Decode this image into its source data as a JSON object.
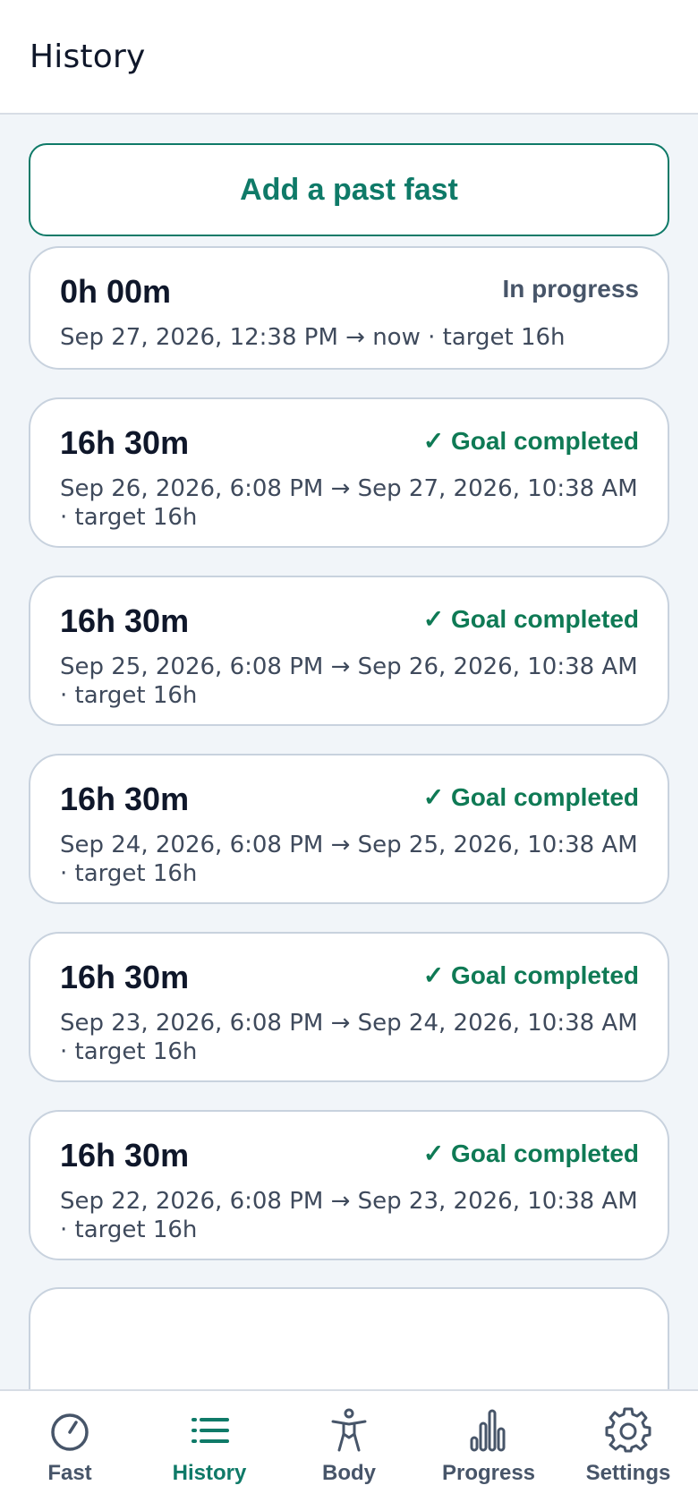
{
  "header": {
    "title": "History"
  },
  "add_button_label": "Add a past fast",
  "fasts": [
    {
      "duration": "0h 00m",
      "status": "In progress",
      "detail": "Sep 27, 2026, 12:38 PM → now · target 16h"
    },
    {
      "duration": "16h 30m",
      "status": "✓ Goal completed",
      "detail": "Sep 26, 2026, 6:08 PM → Sep 27, 2026, 10:38 AM · target 16h"
    },
    {
      "duration": "16h 30m",
      "status": "✓ Goal completed",
      "detail": "Sep 25, 2026, 6:08 PM → Sep 26, 2026, 10:38 AM · target 16h"
    },
    {
      "duration": "16h 30m",
      "status": "✓ Goal completed",
      "detail": "Sep 24, 2026, 6:08 PM → Sep 25, 2026, 10:38 AM · target 16h"
    },
    {
      "duration": "16h 30m",
      "status": "✓ Goal completed",
      "detail": "Sep 23, 2026, 6:08 PM → Sep 24, 2026, 10:38 AM · target 16h"
    },
    {
      "duration": "16h 30m",
      "status": "✓ Goal completed",
      "detail": "Sep 22, 2026, 6:08 PM → Sep 23, 2026, 10:38 AM · target 16h"
    }
  ],
  "nav": {
    "items": [
      {
        "label": "Fast",
        "icon": "timer-icon",
        "active": false
      },
      {
        "label": "History",
        "icon": "list-icon",
        "active": true
      },
      {
        "label": "Body",
        "icon": "body-icon",
        "active": false
      },
      {
        "label": "Progress",
        "icon": "bar-chart-icon",
        "active": false
      },
      {
        "label": "Settings",
        "icon": "gear-icon",
        "active": false
      }
    ]
  },
  "colors": {
    "accent": "#0f7a68",
    "success": "#0f7a55",
    "muted": "#475569",
    "background": "#f1f5f9"
  }
}
